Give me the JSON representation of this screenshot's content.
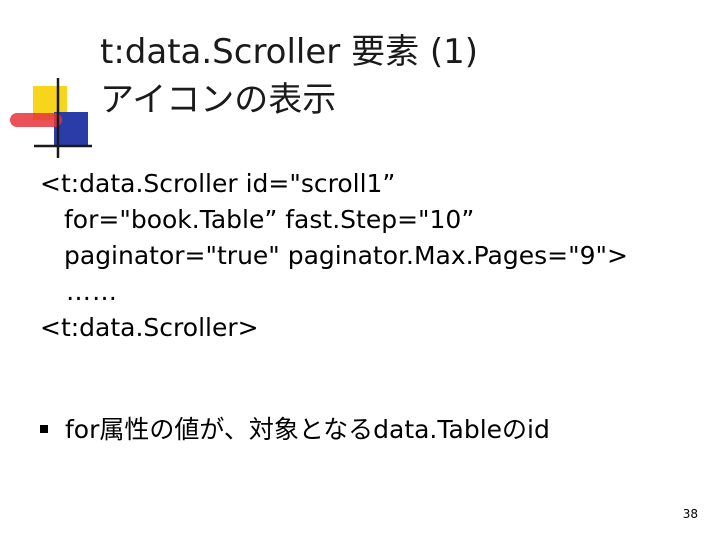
{
  "slide": {
    "title_line1": "t:data.Scroller 要素 (1)",
    "title_line2": "アイコンの表示",
    "code_lines": [
      "<t:data.Scroller  id=\"scroll1”",
      "for=\"book.Table”  fast.Step=\"10”",
      "paginator=\"true\"  paginator.Max.Pages=\"9\">",
      "……",
      "<t:data.Scroller>"
    ],
    "bullet_text": "for属性の値が、対象となるdata.Tableのid",
    "page_number": "38"
  },
  "colors": {
    "logo_yellow": "#f7d51a",
    "logo_blue": "#2a3ca8",
    "logo_red": "#e8323c",
    "logo_line": "#1a1a1a"
  }
}
